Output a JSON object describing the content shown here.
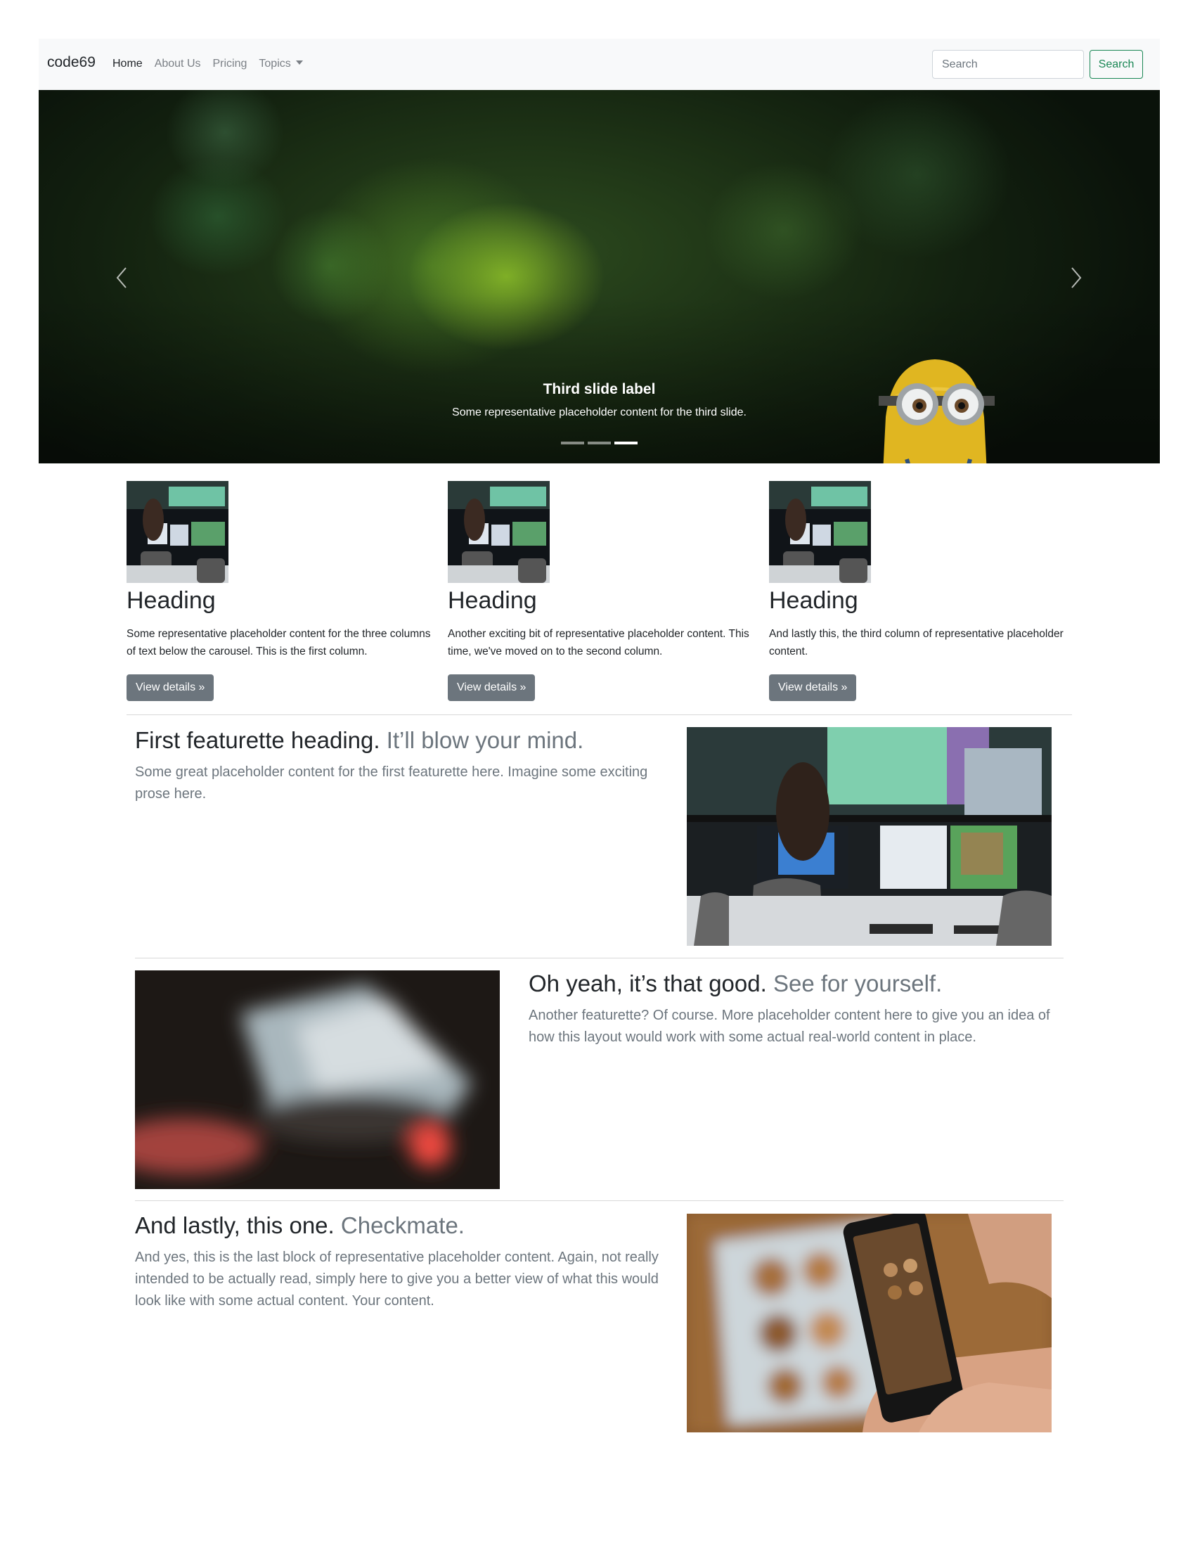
{
  "navbar": {
    "brand": "code69",
    "links": [
      {
        "label": "Home"
      },
      {
        "label": "About Us"
      },
      {
        "label": "Pricing"
      },
      {
        "label": "Topics"
      }
    ],
    "search_placeholder": "Search",
    "search_button": "Search"
  },
  "carousel": {
    "caption_title": "Third slide label",
    "caption_text": "Some representative placeholder content for the third slide.",
    "slide_count": 3,
    "active_slide": 3
  },
  "columns": [
    {
      "heading": "Heading",
      "text": "Some representative placeholder content for the three columns of text below the carousel. This is the first column.",
      "button": "View details »"
    },
    {
      "heading": "Heading",
      "text": "Another exciting bit of representative placeholder content. This time, we've moved on to the second column.",
      "button": "View details »"
    },
    {
      "heading": "Heading",
      "text": "And lastly this, the third column of representative placeholder content.",
      "button": "View details »"
    }
  ],
  "featurettes": [
    {
      "heading": "First featurette heading.",
      "heading_muted": "It’ll blow your mind.",
      "text": "Some great placeholder content for the first featurette here. Imagine some exciting prose here."
    },
    {
      "heading": "Oh yeah, it’s that good.",
      "heading_muted": "See for yourself.",
      "text": "Another featurette? Of course. More placeholder content here to give you an idea of how this layout would work with some actual real-world content in place."
    },
    {
      "heading": "And lastly, this one.",
      "heading_muted": "Checkmate.",
      "text": "And yes, this is the last block of representative placeholder content. Again, not really intended to be actually read, simply here to give you a better view of what this would look like with some actual content. Your content."
    }
  ],
  "colors": {
    "navbar_bg": "#f8f9fa",
    "success": "#198754",
    "secondary": "#6c757d"
  }
}
